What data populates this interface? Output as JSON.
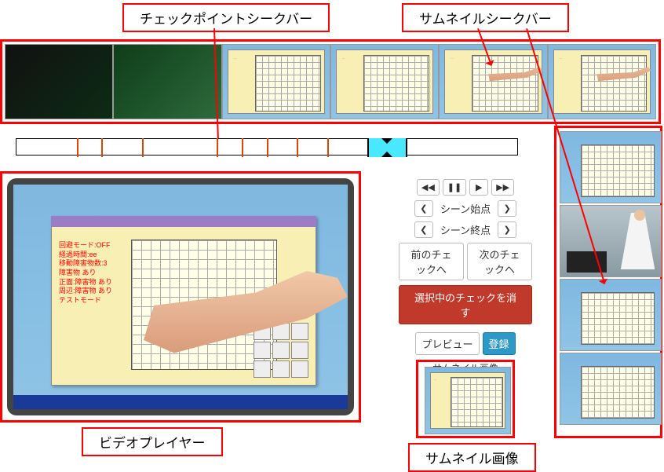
{
  "labels": {
    "checkpoint_seekbar": "チェックポイントシークバー",
    "thumbnail_seekbar": "サムネイルシークバー",
    "video_player": "ビデオプレイヤー",
    "thumbnail_image": "サムネイル画像"
  },
  "controls": {
    "rewind_icon": "◀◀",
    "pause_icon": "❚❚",
    "play_icon": "▶",
    "ffwd_icon": "▶▶",
    "chev_left": "❮",
    "chev_right": "❯",
    "scene_start": "シーン始点",
    "scene_end": "シーン終点",
    "prev_check": "前のチェックへ",
    "next_check": "次のチェックへ",
    "delete_check": "選択中のチェックを消す",
    "preview": "プレビュー",
    "register": "登録",
    "thumbnail_heading": "サムネイル画像"
  },
  "player_text": "回避モード:OFF\n経過時間:ee\n移動障害物数:3\n障害物 あり\n正面:障害物 あり\n周辺:障害物 あり\nテストモード",
  "checkpoint_positions_pct": [
    12,
    17,
    25,
    40,
    45,
    50,
    56,
    62,
    70
  ],
  "checkpoint_current": {
    "left_pct": 70,
    "width_pct": 8
  }
}
